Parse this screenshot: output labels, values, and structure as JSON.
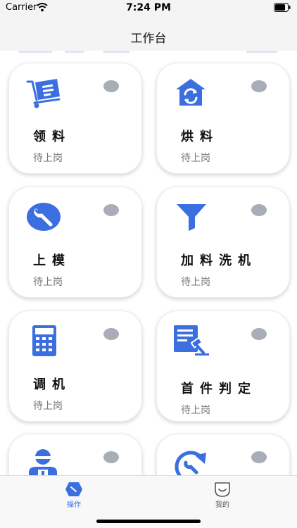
{
  "status_bar": {
    "carrier": "Carrier",
    "time": "7:24 PM"
  },
  "nav": {
    "title": "工作台"
  },
  "cards": [
    {
      "title": "领料",
      "status": "待上岗",
      "icon": "cart-icon"
    },
    {
      "title": "烘料",
      "status": "待上岗",
      "icon": "dryer-icon"
    },
    {
      "title": "上模",
      "status": "待上岗",
      "icon": "wrench-icon"
    },
    {
      "title": "加料洗机",
      "status": "待上岗",
      "icon": "funnel-icon"
    },
    {
      "title": "调机",
      "status": "待上岗",
      "icon": "calculator-icon"
    },
    {
      "title": "首件判定",
      "status": "待上岗",
      "icon": "judgement-doc-icon"
    },
    {
      "title": "",
      "status": "",
      "icon": "worker-icon"
    },
    {
      "title": "",
      "status": "",
      "icon": "refresh-wrench-icon"
    }
  ],
  "tabs": [
    {
      "label": "操作",
      "icon": "operation-icon",
      "active": true
    },
    {
      "label": "我的",
      "icon": "profile-icon",
      "active": false
    }
  ],
  "colors": {
    "accent": "#3b6fe0",
    "dot": "#a9adb7",
    "tab_inactive": "#555555"
  }
}
